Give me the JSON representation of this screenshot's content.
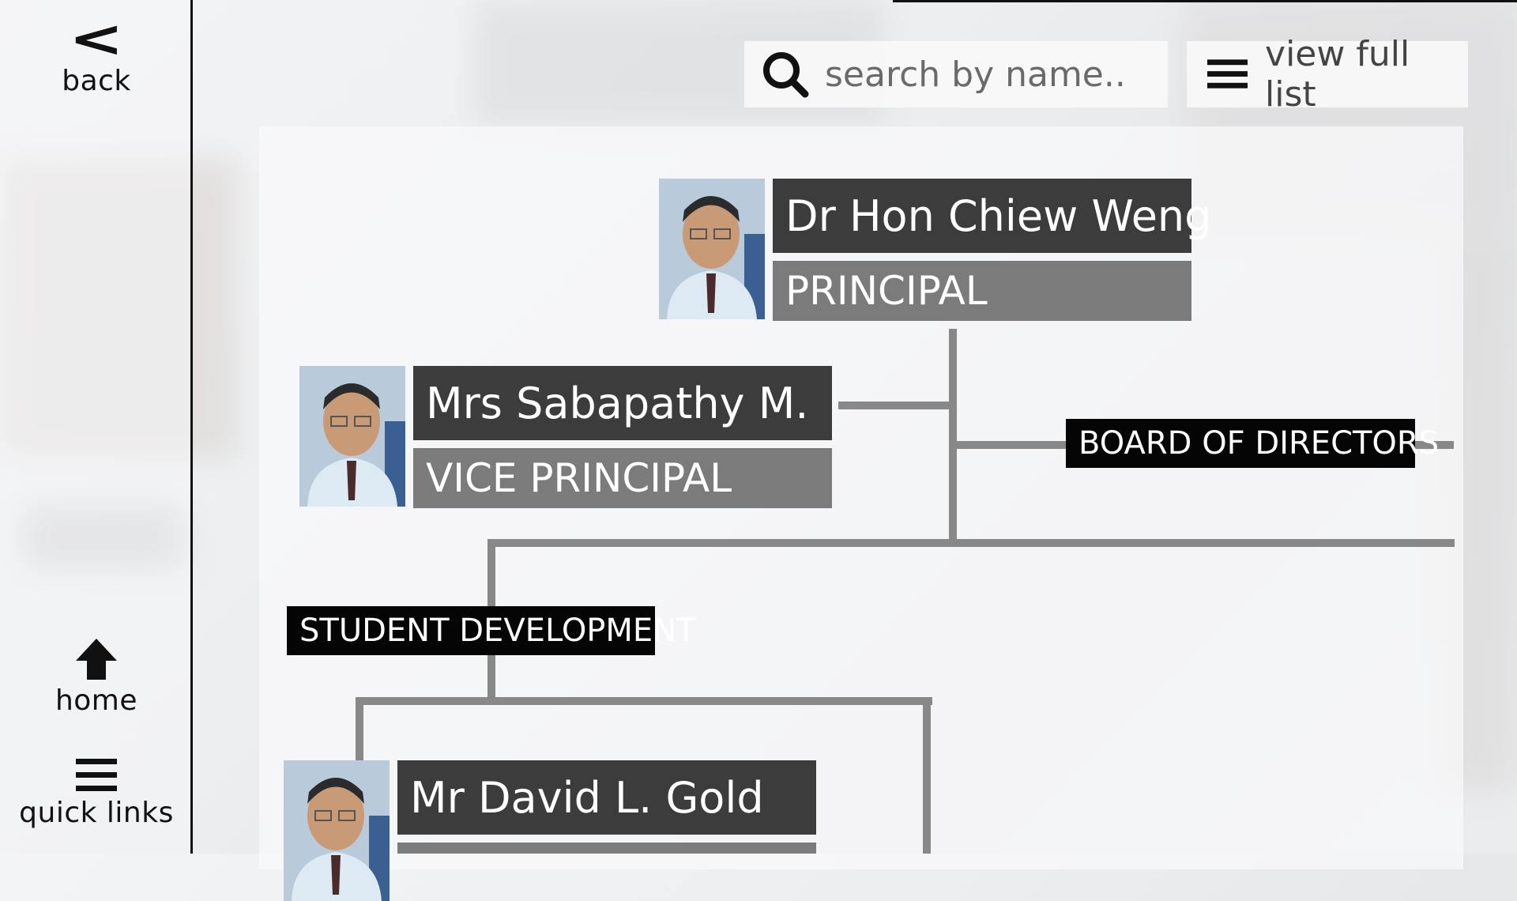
{
  "sidebar": {
    "back_label": "back",
    "home_label": "home",
    "quick_links_label": "quick links"
  },
  "search": {
    "placeholder": "search by name.."
  },
  "view_full_list_label": "view full list",
  "org_chart": {
    "principal": {
      "name": "Dr Hon Chiew Weng",
      "role": "PRINCIPAL"
    },
    "vice_principal": {
      "name": "Mrs Sabapathy M.",
      "role": "VICE PRINCIPAL"
    },
    "board_label": "BOARD OF DIRECTORS",
    "student_dev_label": "STUDENT DEVELOPMENT",
    "staff": {
      "name": "Mr David L. Gold",
      "role": ""
    }
  },
  "colors": {
    "name_bg": "#3c3c3c",
    "role_bg": "#7b7b7b",
    "dept_bg": "#050505",
    "connector": "#888888"
  }
}
